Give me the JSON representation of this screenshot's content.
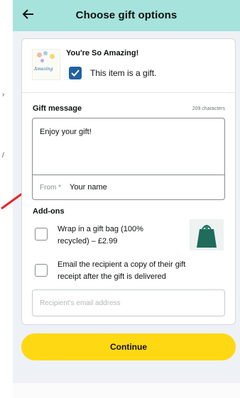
{
  "header": {
    "title": "Choose gift options",
    "back_icon": "arrow-left-icon",
    "bg": "#a6e3dc"
  },
  "item": {
    "title": "You're So Amazing!",
    "thumb_text": "Amazing",
    "is_gift_checked": true,
    "gift_label": "This item is a gift."
  },
  "gift_message": {
    "label": "Gift message",
    "counter": "209 characters",
    "value": "Enjoy your gift!",
    "from_label": "From *",
    "from_value": "Your name"
  },
  "addons": {
    "label": "Add-ons",
    "options": [
      {
        "text_line1": "Wrap in a gift bag (100%",
        "text_line2": "recycled) – £2.99",
        "checked": false,
        "icon": "gift-bag-icon"
      },
      {
        "text_line1": "Email the recipient a copy of their gift",
        "text_line2": "receipt after the gift is delivered",
        "checked": false
      }
    ],
    "email_placeholder": "Recipient's email address"
  },
  "continue_label": "Continue",
  "colors": {
    "accent": "#2162a1",
    "button": "#ffd814",
    "arrow": "#e32626"
  }
}
